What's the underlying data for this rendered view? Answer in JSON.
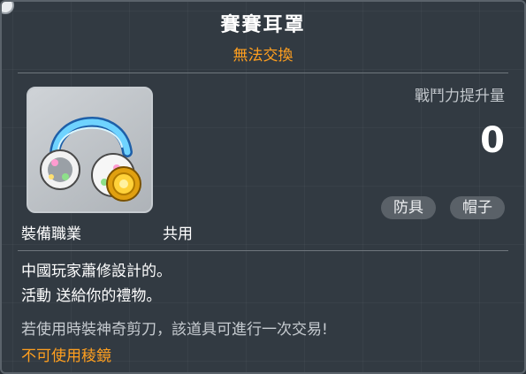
{
  "item": {
    "name": "賽賽耳罩",
    "trade_status": "無法交換",
    "icon": "earmuffs-icon"
  },
  "stats": {
    "power_label": "戰鬥力提升量",
    "power_value": "0"
  },
  "tags": [
    "防具",
    "帽子"
  ],
  "job": {
    "label": "裝備職業",
    "value": "共用"
  },
  "description": [
    "中國玩家蕭修設計的。",
    "活動 送給你的禮物。"
  ],
  "hint": "若使用時裝神奇剪刀，該道具可進行一次交易!",
  "restriction": "不可使用稜鏡",
  "colors": {
    "panel_bg": "#323a42",
    "accent_orange": "#ff9f1f",
    "tag_bg": "#5a6168"
  }
}
